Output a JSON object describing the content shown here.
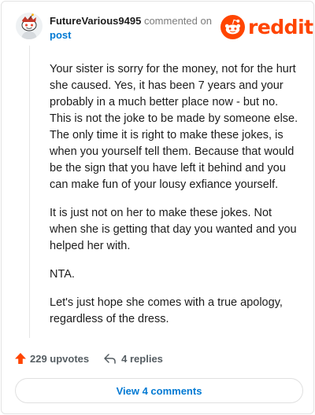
{
  "comment": {
    "username": "FutureVarious9495",
    "action_text": "commented on",
    "post_link": "post",
    "paragraphs": [
      "Your sister is sorry for the money, not for the hurt she caused. Yes, it has been 7 years and your probably in a much better place now - but no. This is not the joke to be made by someone else. The only time it is right to make these jokes, is when you yourself tell them. Because that would be the sign that you have left it behind and you can make fun of your lousy exfiance yourself.",
      "It is just not on her to make these jokes. Not when she is getting that day you wanted and you helped her with.",
      "NTA.",
      "Let's just hope she comes with a true apology, regardless of the dress."
    ]
  },
  "brand": {
    "name": "reddit",
    "color": "#ff4500"
  },
  "actions": {
    "upvotes": "229 upvotes",
    "replies": "4 replies"
  },
  "footer": {
    "view_comments": "View 4 comments"
  },
  "colors": {
    "accent": "#0079d3",
    "upvote": "#ff4500",
    "muted": "#7c7c7c"
  },
  "icons": {
    "avatar": "snoo-avatar",
    "logo": "reddit-snoo-icon",
    "upvote": "upvote-arrow-icon",
    "reply": "reply-arrow-icon"
  }
}
